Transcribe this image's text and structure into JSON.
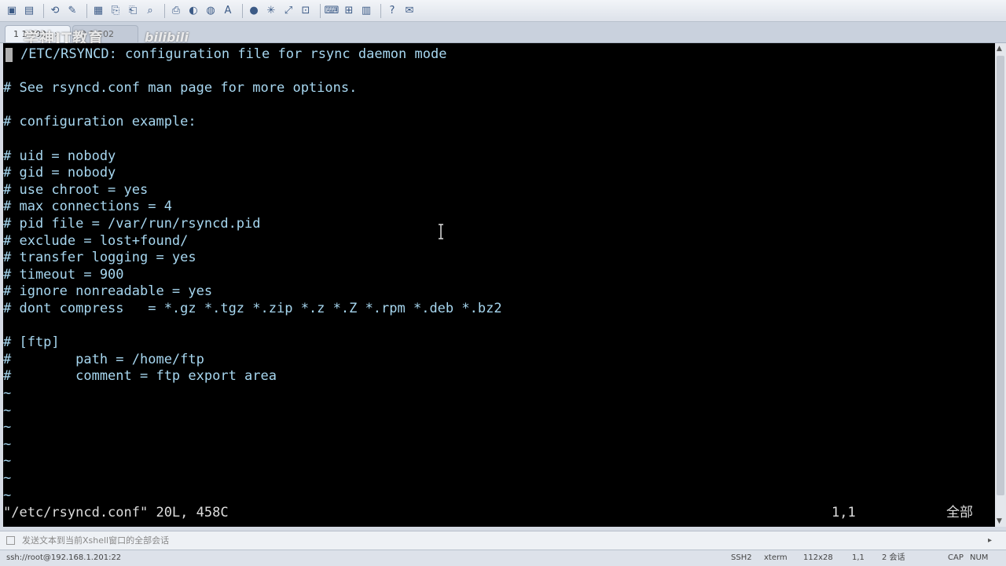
{
  "tabs": [
    {
      "label": "1 1.202",
      "close": "×"
    },
    {
      "label": "2 1.202"
    }
  ],
  "watermark": {
    "text": "学神IT教育",
    "logo": "bilibili"
  },
  "tab_nav": {
    "prev": "◀",
    "next": "▶",
    "close": "×"
  },
  "terminal": {
    "lines": [
      "/ETC/RSYNCD: configuration file for rsync daemon mode",
      "",
      "# See rsyncd.conf man page for more options.",
      "",
      "# configuration example:",
      "",
      "# uid = nobody",
      "# gid = nobody",
      "# use chroot = yes",
      "# max connections = 4",
      "# pid file = /var/run/rsyncd.pid",
      "# exclude = lost+found/",
      "# transfer logging = yes",
      "# timeout = 900",
      "# ignore nonreadable = yes",
      "# dont compress   = *.gz *.tgz *.zip *.z *.Z *.rpm *.deb *.bz2",
      "",
      "# [ftp]",
      "#        path = /home/ftp",
      "#        comment = ftp export area",
      "~",
      "~",
      "~",
      "~",
      "~",
      "~",
      "~"
    ],
    "status_file": "\"/etc/rsyncd.conf\" 20L, 458C",
    "status_pos": "1,1",
    "status_all": "全部"
  },
  "compose": {
    "placeholder": "发送文本到当前Xshell窗口的全部会话",
    "menu": "▸"
  },
  "statusbar": {
    "connection": "ssh://root@192.168.1.201:22",
    "protocol": "SSH2",
    "term": "xterm",
    "size": "112x28",
    "cursor": "1,1",
    "sessions": "2 会话",
    "cap": "CAP",
    "num": "NUM"
  },
  "colors": {
    "terminal_text": "#a7d7f0",
    "terminal_bg": "#000000",
    "status_text": "#dddddd"
  }
}
